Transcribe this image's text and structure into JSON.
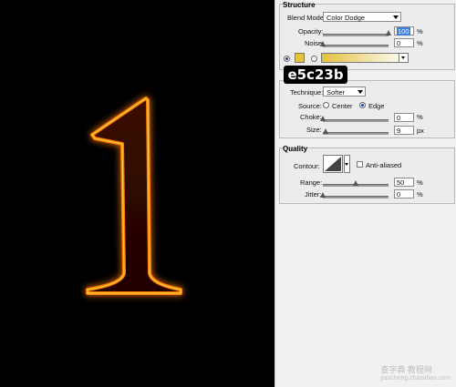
{
  "canvas": {
    "glyph": "1",
    "glow_color": "#ff8a00",
    "core_color": "#ffd34a"
  },
  "structure": {
    "title": "Structure",
    "blend_mode_label": "Blend Mode:",
    "blend_mode_value": "Color Dodge",
    "opacity_label": "Opacity:",
    "opacity_value": "100",
    "opacity_unit": "%",
    "opacity_level": 1.0,
    "noise_label": "Noise:",
    "noise_value": "0",
    "noise_unit": "%",
    "noise_level": 0.0,
    "color_swatch": "#e5c23b"
  },
  "elements": {
    "technique_label": "Technique:",
    "technique_value": "Softer",
    "source_label": "Source:",
    "source_center": "Center",
    "source_edge": "Edge",
    "choke_label": "Choke:",
    "choke_value": "0",
    "choke_unit": "%",
    "choke_level": 0.0,
    "size_label": "Size:",
    "size_value": "9",
    "size_unit": "px",
    "size_level": 0.04
  },
  "quality": {
    "title": "Quality",
    "contour_label": "Contour:",
    "anti_aliased_label": "Anti-aliased",
    "range_label": "Range:",
    "range_value": "50",
    "range_unit": "%",
    "range_level": 0.5,
    "jitter_label": "Jitter:",
    "jitter_value": "0",
    "jitter_unit": "%",
    "jitter_level": 0.0
  },
  "overlay_tag": "e5c23b",
  "watermark": {
    "main": "查字典 教程网",
    "sub": "jiaocheng.chazidian.com"
  }
}
